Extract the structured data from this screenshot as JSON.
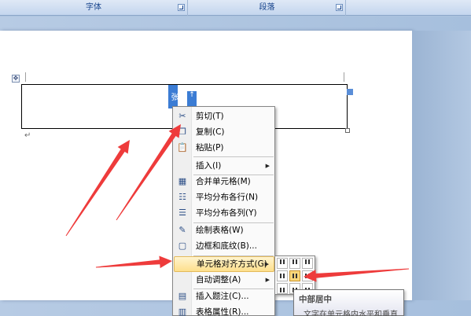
{
  "ribbon": {
    "groups": [
      {
        "label": "字体"
      },
      {
        "label": "段落"
      }
    ]
  },
  "document": {
    "cell_text_1": "张",
    "cell_text_2": "↑",
    "para_mark": "↵"
  },
  "context_menu": {
    "items": [
      {
        "label": "剪切(T)",
        "icon": "scissors-icon"
      },
      {
        "label": "复制(C)",
        "icon": "copy-icon"
      },
      {
        "label": "粘贴(P)",
        "icon": "paste-icon"
      },
      {
        "label": "插入(I)",
        "icon": "",
        "submenu": true
      },
      {
        "label": "合并单元格(M)",
        "icon": "merge-cells-icon"
      },
      {
        "label": "平均分布各行(N)",
        "icon": "distribute-rows-icon"
      },
      {
        "label": "平均分布各列(Y)",
        "icon": "distribute-columns-icon"
      },
      {
        "label": "绘制表格(W)",
        "icon": "draw-table-icon"
      },
      {
        "label": "边框和底纹(B)...",
        "icon": "borders-icon"
      },
      {
        "label": "单元格对齐方式(G)",
        "icon": "",
        "submenu": true,
        "highlighted": true
      },
      {
        "label": "自动调整(A)",
        "icon": "",
        "submenu": true
      },
      {
        "label": "插入题注(C)...",
        "icon": "caption-icon"
      },
      {
        "label": "表格属性(R)...",
        "icon": "table-properties-icon"
      }
    ]
  },
  "tooltip": {
    "title": "中部居中",
    "description": "文字在单元格内水平和垂直"
  },
  "colors": {
    "arrow": "#ee3b3b",
    "highlight": "#fddf8c",
    "ribbon_text": "#15428b"
  }
}
